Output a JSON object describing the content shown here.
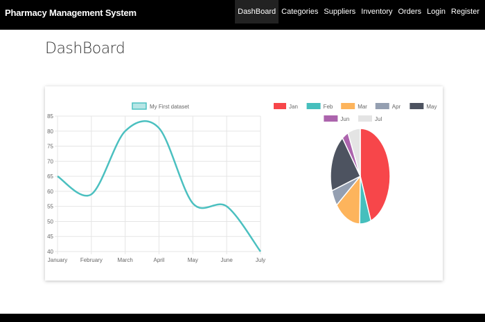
{
  "navbar": {
    "brand": "Pharmacy Management System",
    "items": [
      {
        "label": "DashBoard",
        "active": true
      },
      {
        "label": "Categories",
        "active": false
      },
      {
        "label": "Suppliers",
        "active": false
      },
      {
        "label": "Inventory",
        "active": false
      },
      {
        "label": "Orders",
        "active": false
      },
      {
        "label": "Login",
        "active": false
      },
      {
        "label": "Register",
        "active": false
      }
    ]
  },
  "page": {
    "title": "DashBoard"
  },
  "colors": {
    "line": "#4bc0c0",
    "grid": "#e5e5e5",
    "text": "#666666"
  },
  "chart_data": [
    {
      "type": "line",
      "categories": [
        "January",
        "February",
        "March",
        "April",
        "May",
        "June",
        "July"
      ],
      "series": [
        {
          "name": "My First dataset",
          "values": [
            65,
            59,
            80,
            81,
            56,
            55,
            40
          ]
        }
      ],
      "ylim": [
        40,
        85
      ],
      "yticks": [
        40,
        45,
        50,
        55,
        60,
        65,
        70,
        75,
        80,
        85
      ],
      "grid": true,
      "legend": "top"
    },
    {
      "type": "pie",
      "labels": [
        "Jan",
        "Feb",
        "Mar",
        "Apr",
        "May",
        "Jun",
        "Jul"
      ],
      "values": [
        65,
        9,
        21,
        8,
        29,
        5,
        10
      ],
      "colors": [
        "#f7464a",
        "#46bfbd",
        "#fdb45c",
        "#949fb1",
        "#4d5360",
        "#ac64ad",
        "#e4e4e4"
      ],
      "legend": "top"
    }
  ]
}
